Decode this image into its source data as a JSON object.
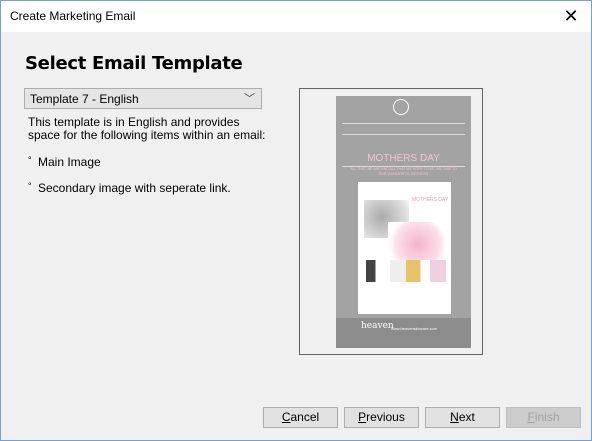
{
  "window": {
    "title": "Create Marketing Email",
    "close_icon": "close-x"
  },
  "main": {
    "heading": "Select Email Template",
    "template_select": {
      "value": "Template 7 - English"
    },
    "description": "This template is in English and provides space for the following items within an email:",
    "items": [
      {
        "label": "Main Image"
      },
      {
        "label": "Secondary image with seperate link."
      }
    ]
  },
  "preview": {
    "headline": "MOTHERS DAY",
    "slogan": "ALL THAT WE ARE AND ALL THAT WE HOPE TO BE, WE OWE TO OUR WONDERFUL MOTHERS",
    "poster_headline": "MOTHERS DAY",
    "brand": "heaven",
    "website": "www.heavenskincare.com"
  },
  "buttons": {
    "cancel": {
      "first": "C",
      "rest": "ancel"
    },
    "previous": {
      "first": "P",
      "rest": "revious"
    },
    "next": {
      "first": "N",
      "rest": "ext"
    },
    "finish": {
      "first": "F",
      "rest": "inish",
      "enabled": false
    }
  }
}
